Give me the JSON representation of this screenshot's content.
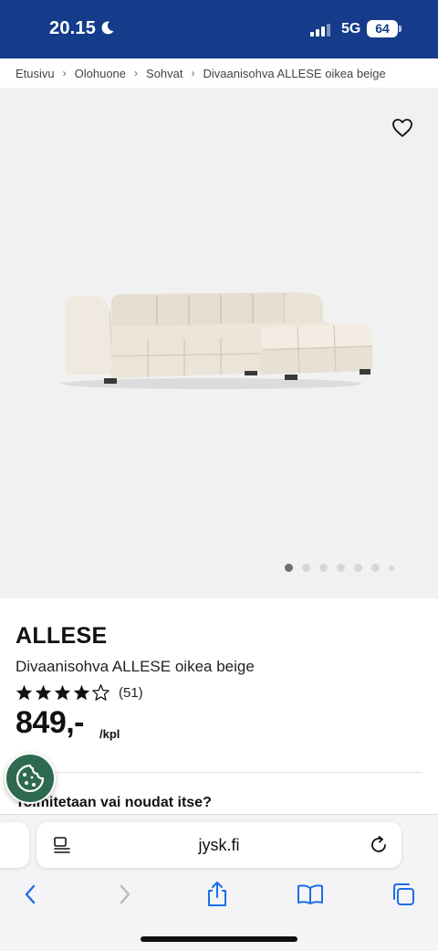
{
  "status_bar": {
    "time": "20.15",
    "network": "5G",
    "battery": "64"
  },
  "breadcrumb": [
    "Etusivu",
    "Olohuone",
    "Sohvat",
    "Divaanisohva ALLESE oikea beige"
  ],
  "gallery": {
    "image_count": 7,
    "active_index": 0
  },
  "product": {
    "brand": "ALLESE",
    "name": "Divaanisohva ALLESE oikea beige",
    "rating": 4,
    "rating_max": 5,
    "review_count": "(51)",
    "price": "849,-",
    "unit": "/kpl",
    "delivery_heading": "Toimitetaan vai noudat itse?"
  },
  "browser": {
    "url": "jysk.fi"
  },
  "colors": {
    "brand_blue": "#143c8a",
    "cookie_green": "#2d6a4f",
    "ios_blue": "#1a6fe8"
  },
  "icons": {
    "favorite": "heart-outline-icon",
    "cookie": "cookie-icon",
    "back": "chevron-left-icon",
    "forward": "chevron-right-icon",
    "share": "share-icon",
    "bookmarks": "book-icon",
    "tabs": "tabs-icon"
  }
}
